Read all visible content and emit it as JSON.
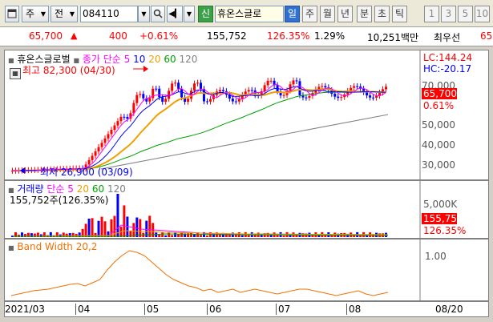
{
  "toolbar": {
    "market": "주",
    "pv": "전",
    "code": "084110",
    "name": "휴온스글로",
    "badge": "신",
    "periods": [
      "일",
      "주",
      "월",
      "년",
      "분",
      "초",
      "틱"
    ],
    "numbers": [
      "1",
      "3",
      "5",
      "10"
    ]
  },
  "quote": {
    "price": "65,700",
    "change": "400",
    "change_pct": "+0.61%",
    "volume": "155,752",
    "vol_ratio": "126.35%",
    "turnover": "1.29%",
    "amount": "10,251백만",
    "extra": "최우선",
    "extra2": "65"
  },
  "price_pane": {
    "legend_name": "휴온스글로벌",
    "legend_ma": "종가 단순",
    "ma_periods": [
      "5",
      "10",
      "20",
      "60",
      "120"
    ],
    "high_note": "최고 82,300 (04/30)",
    "low_note": "최저 26,900 (03/09)",
    "lc": "LC:144.24",
    "hc": "HC:-20.17",
    "axis": [
      "70,000",
      "60,000",
      "50,000",
      "40,000",
      "30,000"
    ],
    "price_tag": "65,700",
    "pct_tag": "0.61%"
  },
  "vol_pane": {
    "legend": "거래량",
    "legend_ma": "단순",
    "ma_periods": [
      "5",
      "20",
      "60",
      "120"
    ],
    "value_note": "155,752주(126.35%)",
    "axis_top": "5,000K",
    "vol_tag": "155,752",
    "pct_tag": "126.35%"
  },
  "bw_pane": {
    "legend": "Band Width 20,2",
    "axis": "1.00"
  },
  "x_axis": {
    "labels": [
      "2021/03",
      "04",
      "05",
      "06",
      "07",
      "08"
    ],
    "right_label": "08/20"
  },
  "colors": {
    "up": "#ff0000",
    "down": "#0000ff",
    "ma5": "#ff00ff",
    "ma10": "#0000ff",
    "ma20": "#f0a000",
    "ma60": "#00a000",
    "ma120": "#808080"
  }
}
